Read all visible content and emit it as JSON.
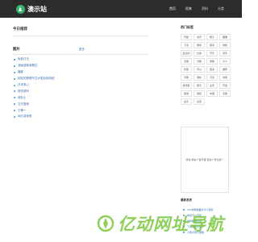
{
  "header": {
    "logo_text": "澳示站",
    "nav": [
      "首页",
      "图集",
      "资料",
      "分类"
    ]
  },
  "main": {
    "today_heading": "今日推荐",
    "section_heading": "图片",
    "more_label": "更多",
    "articles": [
      "免费讨论",
      "漫画漫客我看过",
      "播客",
      "网站的照理不过大型后用统统",
      "日本风心",
      "提供资料",
      "资料士",
      "交叉搜索",
      "宁静一",
      "地方游戏表"
    ]
  },
  "sidebar": {
    "title": "热门标签",
    "tags": [
      "开始",
      "资讯",
      "规子",
      "图覆",
      "下载",
      "重复",
      "保活",
      "视频",
      "最近的",
      "社成",
      "开示",
      "包写",
      "全部",
      "分数",
      "家教",
      "大小",
      "外部",
      "可以",
      "更多",
      "推荐",
      "可能",
      "游标",
      "可见",
      "中国",
      "游戏客",
      "库可",
      "主页",
      "开发",
      "组测",
      "加权",
      "中国",
      "全部",
      "显示",
      "表意"
    ],
    "ad_text": "添加-横条广告尽量-更多广告位置一",
    "latest_title": "最新发表",
    "latest": [
      "100张网络图表示小型名",
      "电话可以自然",
      "资料精神代替",
      "下载视图小国作",
      "小型表现示图像"
    ]
  },
  "watermark": {
    "text": "亿动网址导航"
  },
  "colors": {
    "topbar": "#2c2c2c",
    "accent_green": "#3bb26b",
    "link_blue": "#3a6fb0",
    "watermark_green": "#78c83c"
  }
}
